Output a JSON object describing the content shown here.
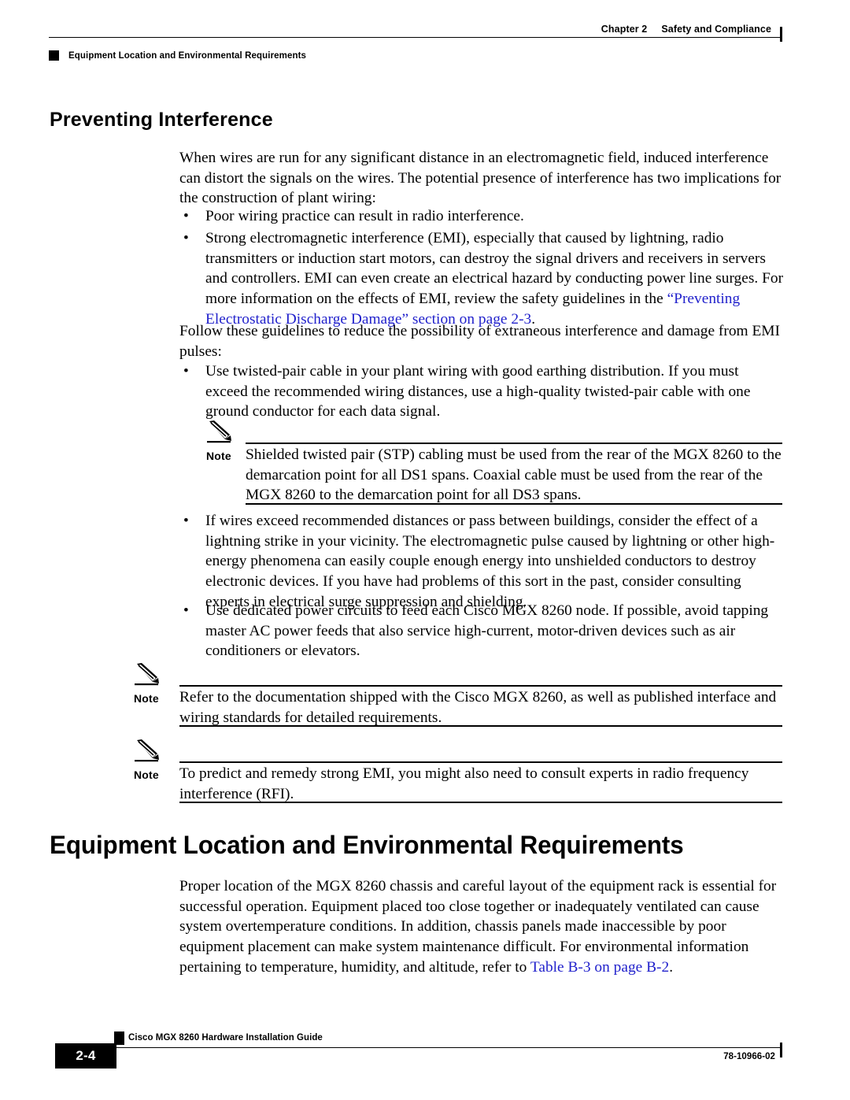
{
  "header": {
    "chapter_label": "Chapter 2",
    "chapter_title": "Safety and Compliance",
    "running_section": "Equipment Location and Environmental Requirements"
  },
  "colors": {
    "link": "#2222cc",
    "text": "#000000",
    "page_background": "#ffffff"
  },
  "sections": {
    "preventing_interference": {
      "heading": "Preventing Interference",
      "intro": "When wires are run for any significant distance in an electromagnetic field, induced interference can distort the signals on the wires. The potential presence of interference has two implications for the construction of plant wiring:",
      "bullets": [
        {
          "marker": "•",
          "text": "Poor wiring practice can result in radio interference."
        },
        {
          "marker": "•",
          "text_before_link": "Strong electromagnetic interference (EMI), especially that caused by lightning, radio transmitters or induction start motors, can destroy the signal drivers and receivers in servers and controllers. EMI can even create an electrical hazard by conducting power line surges. For more information on the effects of EMI, review the safety guidelines in the ",
          "link_text": "“Preventing Electrostatic Discharge Damage” section on page 2-3",
          "text_after_link": "."
        }
      ],
      "guidelines_intro": "Follow these guidelines to reduce the possibility of extraneous interference and damage from EMI pulses:",
      "guideline_bullets": [
        {
          "marker": "•",
          "text": "Use twisted-pair cable in your plant wiring with good earthing distribution. If you must exceed the recommended wiring distances, use a high-quality twisted-pair cable with one ground conductor for each data signal."
        },
        {
          "marker": "•",
          "text": "If wires exceed recommended distances or pass between buildings, consider the effect of a lightning strike in your vicinity. The electromagnetic pulse caused by lightning or other high-energy phenomena can easily couple enough energy into unshielded conductors to destroy electronic devices. If you have had problems of this sort in the past, consider consulting experts in electrical surge suppression and shielding."
        },
        {
          "marker": "•",
          "text": "Use dedicated power circuits to feed each Cisco MGX 8260 node. If possible, avoid tapping master AC power feeds that also service high-current, motor-driven devices such as air conditioners or elevators."
        }
      ]
    },
    "equipment_location": {
      "heading": "Equipment Location and Environmental Requirements",
      "paragraph_before_link": "Proper location of the MGX 8260 chassis and careful layout of the equipment rack is essential for successful operation. Equipment placed too close together or inadequately ventilated can cause system overtemperature conditions. In addition, chassis panels made inaccessible by poor equipment placement can make system maintenance difficult. For environmental information pertaining to temperature, humidity, and altitude, refer to ",
      "link_text": "Table B-3 on page B-2",
      "paragraph_after_link": "."
    }
  },
  "notes": [
    {
      "label": "Note",
      "icon": "pencil-icon",
      "text": "Shielded twisted pair (STP) cabling must be used from the rear of the MGX 8260 to the demarcation point for all DS1 spans. Coaxial cable must be used from the rear of the MGX 8260 to the demarcation point for all DS3 spans."
    },
    {
      "label": "Note",
      "icon": "pencil-icon",
      "text": "Refer to the documentation shipped with the Cisco MGX 8260, as well as published interface and wiring standards for detailed requirements."
    },
    {
      "label": "Note",
      "icon": "pencil-icon",
      "text": "To predict and remedy strong EMI, you might also need to consult experts in radio frequency interference (RFI)."
    }
  ],
  "footer": {
    "guide_title": "Cisco MGX 8260 Hardware Installation Guide",
    "page_number": "2-4",
    "document_number": "78-10966-02"
  }
}
